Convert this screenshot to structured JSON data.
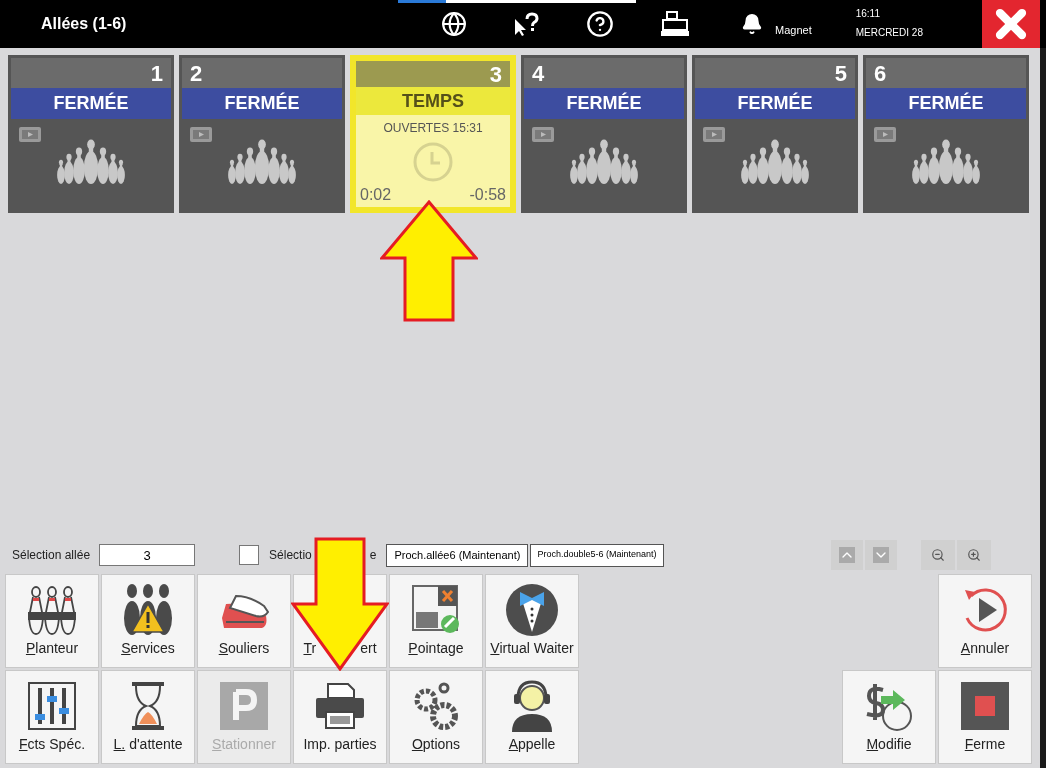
{
  "header": {
    "title": "Allées (1-6)",
    "user": "Magnet",
    "time": "16:11",
    "date": "MERCREDI 28"
  },
  "lanes": [
    {
      "kind": "closed",
      "number": "1",
      "status": "FERMÉE",
      "selected": false
    },
    {
      "kind": "closed",
      "number": "2",
      "status": "FERMÉE",
      "selected": false
    },
    {
      "kind": "timed",
      "number": "3",
      "status": "TEMPS",
      "opened": "OUVERTES 15:31",
      "elapsed": "0:02",
      "remaining": "-0:58",
      "selected": true
    },
    {
      "kind": "closed",
      "number": "4",
      "status": "FERMÉE",
      "selected": false
    },
    {
      "kind": "closed",
      "number": "5",
      "status": "FERMÉE",
      "selected": false
    },
    {
      "kind": "closed",
      "number": "6",
      "status": "FERMÉE",
      "selected": false
    }
  ],
  "selection_bar": {
    "lane_label": "Sélection allée",
    "lane_value": "3",
    "multi_checked": false,
    "multi_label_parts": [
      "Sélectio",
      "e"
    ],
    "next_buttons": [
      "Proch.allée6 (Maintenant)",
      "Proch.double5-6 (Maintenant)"
    ]
  },
  "left_buttons": [
    {
      "label_parts": [
        "Planteur"
      ],
      "underline_first": true,
      "disabled": false
    },
    {
      "label_parts": [
        "Services"
      ],
      "underline_first": true,
      "disabled": false
    },
    {
      "label_parts": [
        "Souliers"
      ],
      "underline_first": true,
      "disabled": false
    },
    {
      "label_parts": [
        "Tr",
        "ert"
      ],
      "underline_first": true,
      "disabled": false
    },
    {
      "label_parts": [
        "Pointage"
      ],
      "underline_first": true,
      "disabled": false
    },
    {
      "label_parts": [
        "Virtual Waiter"
      ],
      "underline_first": true,
      "disabled": false
    },
    {
      "label_parts": [
        "Fcts Spéc."
      ],
      "underline_first": true,
      "disabled": false
    },
    {
      "label_parts": [
        "L. d'attente"
      ],
      "underline_first": true,
      "disabled": false
    },
    {
      "label_parts": [
        "Stationner"
      ],
      "underline_first": true,
      "disabled": true
    },
    {
      "label_parts": [
        "Imp. parties"
      ],
      "underline_first": false,
      "disabled": false
    },
    {
      "label_parts": [
        "Options"
      ],
      "underline_first": true,
      "disabled": false
    },
    {
      "label_parts": [
        "Appelle"
      ],
      "underline_first": true,
      "disabled": false
    }
  ],
  "right_buttons": [
    {
      "label": "Annuler",
      "underline_first": true
    },
    {
      "label": "Modifie",
      "underline_first": true
    },
    {
      "label": "Ferme",
      "underline_first": true
    }
  ]
}
